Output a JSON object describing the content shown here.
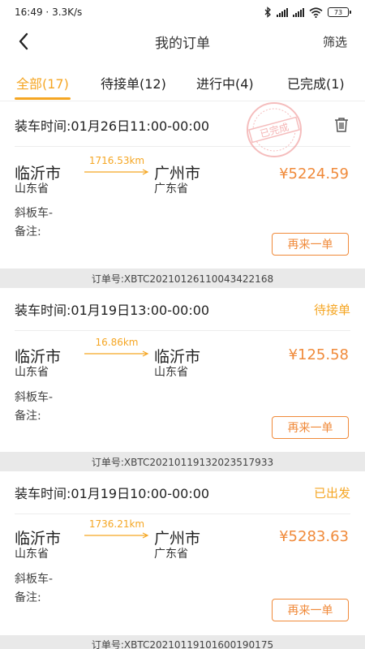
{
  "status_bar": {
    "time": "16:49",
    "speed": "3.3K/s",
    "battery": "73"
  },
  "nav": {
    "title": "我的订单",
    "filter_label": "筛选"
  },
  "tabs": [
    {
      "label": "全部(17)",
      "active": true
    },
    {
      "label": "待接单(12)",
      "active": false
    },
    {
      "label": "进行中(4)",
      "active": false
    },
    {
      "label": "已完成(1)",
      "active": false
    }
  ],
  "orders": [
    {
      "load_time": "装车时间:01月26日11:00-00:00",
      "status": "",
      "stamp_text": "已完成",
      "origin_city": "临沂市",
      "origin_province": "山东省",
      "distance": "1716.53km",
      "dest_city": "广州市",
      "dest_province": "广东省",
      "price": "¥5224.59",
      "vehicle": "斜板车-",
      "remark": "备注:",
      "action_label": "再来一单",
      "order_no": "订单号:XBTC20210126110043422168"
    },
    {
      "load_time": "装车时间:01月19日13:00-00:00",
      "status": "待接单",
      "origin_city": "临沂市",
      "origin_province": "山东省",
      "distance": "16.86km",
      "dest_city": "临沂市",
      "dest_province": "山东省",
      "price": "¥125.58",
      "vehicle": "斜板车-",
      "remark": "备注:",
      "action_label": "再来一单",
      "order_no": "订单号:XBTC20210119132023517933"
    },
    {
      "load_time": "装车时间:01月19日10:00-00:00",
      "status": "已出发",
      "origin_city": "临沂市",
      "origin_province": "山东省",
      "distance": "1736.21km",
      "dest_city": "广州市",
      "dest_province": "广东省",
      "price": "¥5283.63",
      "vehicle": "斜板车-",
      "remark": "备注:",
      "action_label": "再来一单",
      "order_no": "订单号:XBTC20210119101600190175"
    }
  ],
  "colors": {
    "accent": "#f5a623",
    "price": "#f08a3a",
    "strip_bg": "#e9e9e9"
  }
}
